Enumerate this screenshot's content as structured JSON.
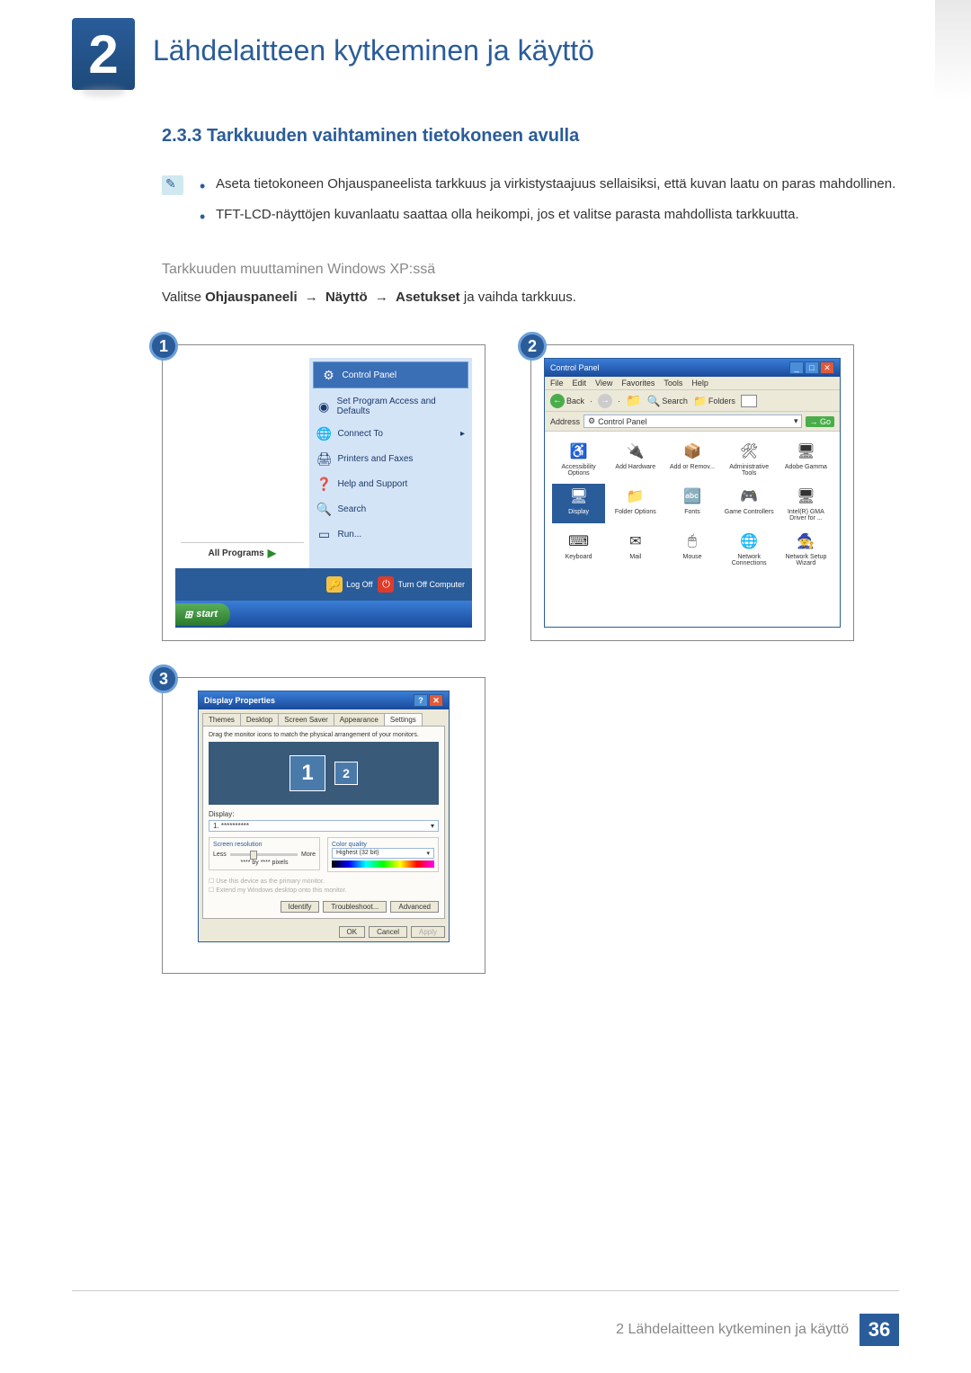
{
  "chapter": {
    "number": "2",
    "title": "Lähdelaitteen kytkeminen ja käyttö"
  },
  "section": {
    "number": "2.3.3",
    "title": "Tarkkuuden vaihtaminen tietokoneen avulla"
  },
  "notes": [
    "Aseta tietokoneen Ohjauspaneelista tarkkuus ja virkistystaajuus sellaisiksi, että kuvan laatu on paras mahdollinen.",
    "TFT-LCD-näyttöjen kuvanlaatu saattaa olla heikompi, jos et valitse parasta mahdollista tarkkuutta."
  ],
  "subsection": {
    "title": "Tarkkuuden muuttaminen Windows XP:ssä",
    "instruction_prefix": "Valitse ",
    "path": [
      "Ohjauspaneeli",
      "Näyttö",
      "Asetukset"
    ],
    "instruction_suffix": " ja vaihda tarkkuus."
  },
  "arrow_glyph": "→",
  "steps": {
    "s1": "1",
    "s2": "2",
    "s3": "3"
  },
  "shot1": {
    "items": {
      "control_panel": "Control Panel",
      "set_access": "Set Program Access and Defaults",
      "connect": "Connect To",
      "printers": "Printers and Faxes",
      "help": "Help and Support",
      "search": "Search",
      "run": "Run..."
    },
    "all_programs": "All Programs",
    "log_off": "Log Off",
    "turn_off": "Turn Off Computer",
    "start": "start"
  },
  "shot2": {
    "title": "Control Panel",
    "menu": [
      "File",
      "Edit",
      "View",
      "Favorites",
      "Tools",
      "Help"
    ],
    "toolbar": {
      "back": "Back",
      "search": "Search",
      "folders": "Folders"
    },
    "address_label": "Address",
    "address_value": "Control Panel",
    "go": "Go",
    "icons": [
      {
        "name": "Accessibility Options",
        "glyph": "♿"
      },
      {
        "name": "Add Hardware",
        "glyph": "🔌"
      },
      {
        "name": "Add or Remov...",
        "glyph": "📦"
      },
      {
        "name": "Administrative Tools",
        "glyph": "🛠"
      },
      {
        "name": "Adobe Gamma",
        "glyph": "🖥"
      },
      {
        "name": "Display",
        "glyph": "🖥",
        "selected": true
      },
      {
        "name": "Folder Options",
        "glyph": "📁"
      },
      {
        "name": "Fonts",
        "glyph": "🔤"
      },
      {
        "name": "Game Controllers",
        "glyph": "🎮"
      },
      {
        "name": "Intel(R) GMA Driver for ...",
        "glyph": "🖥"
      },
      {
        "name": "Keyboard",
        "glyph": "⌨"
      },
      {
        "name": "Mail",
        "glyph": "✉"
      },
      {
        "name": "Mouse",
        "glyph": "🖱"
      },
      {
        "name": "Network Connections",
        "glyph": "🌐"
      },
      {
        "name": "Network Setup Wizard",
        "glyph": "🧙"
      }
    ]
  },
  "shot3": {
    "title": "Display Properties",
    "tabs": [
      "Themes",
      "Desktop",
      "Screen Saver",
      "Appearance",
      "Settings"
    ],
    "active_tab": 4,
    "instruction": "Drag the monitor icons to match the physical arrangement of your monitors.",
    "mon1": "1",
    "mon2": "2",
    "display_label": "Display:",
    "display_value": "1. **********",
    "screen_res_label": "Screen resolution",
    "less": "Less",
    "more": "More",
    "res_value": "**** by **** pixels",
    "color_quality_label": "Color quality",
    "color_quality_value": "Highest (32 bit)",
    "check1": "Use this device as the primary monitor.",
    "check2": "Extend my Windows desktop onto this monitor.",
    "btn_identify": "Identify",
    "btn_troubleshoot": "Troubleshoot...",
    "btn_advanced": "Advanced",
    "btn_ok": "OK",
    "btn_cancel": "Cancel",
    "btn_apply": "Apply"
  },
  "footer": {
    "text": "2 Lähdelaitteen kytkeminen ja käyttö",
    "page": "36"
  }
}
